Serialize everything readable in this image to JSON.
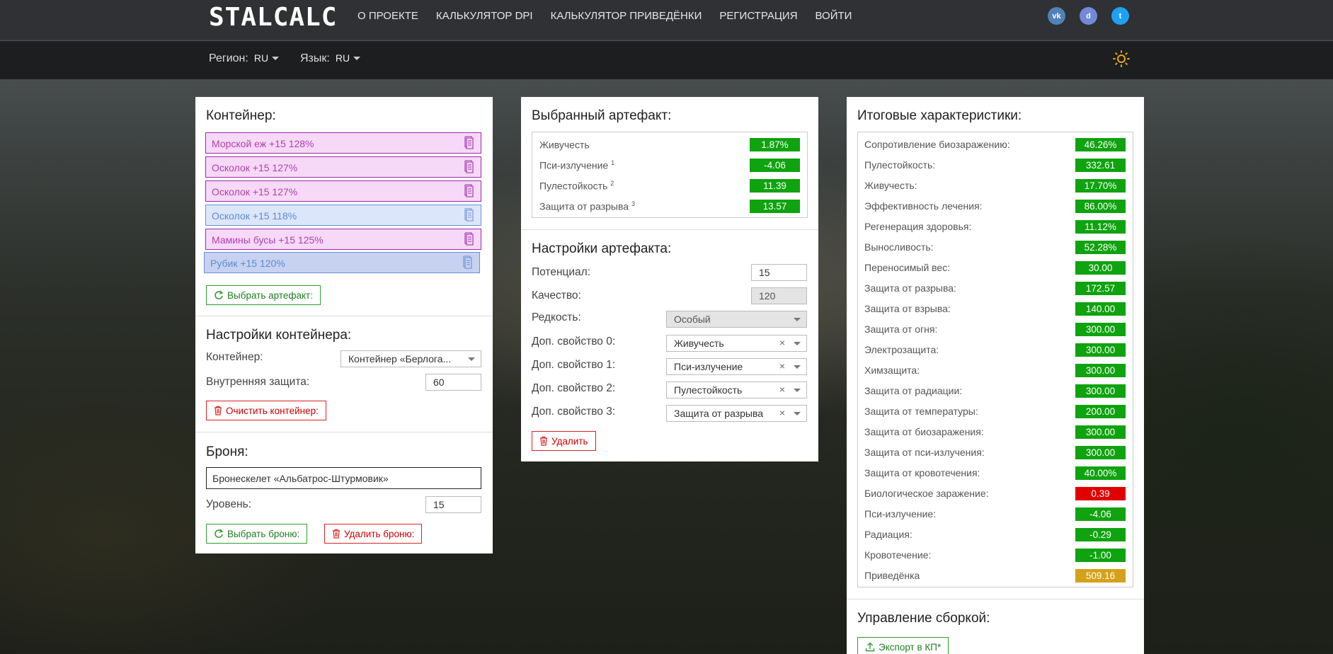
{
  "nav": {
    "logo": "STALCALC",
    "links": [
      "О ПРОЕКТЕ",
      "КАЛЬКУЛЯТОР DPI",
      "КАЛЬКУЛЯТОР ПРИВЕДЁНКИ",
      "РЕГИСТРАЦИЯ",
      "ВОЙТИ"
    ],
    "social": [
      {
        "icon": "vk-icon",
        "text": "vk",
        "color": "#5181b8"
      },
      {
        "icon": "discord-icon",
        "text": "d",
        "color": "#7289da"
      },
      {
        "icon": "twitter-icon",
        "text": "t",
        "color": "#1da1f2"
      }
    ]
  },
  "subbar": {
    "region_label": "Регион:",
    "region_value": "RU",
    "lang_label": "Язык:",
    "lang_value": "RU"
  },
  "container": {
    "title": "Контейнер:",
    "artifacts": [
      {
        "text": "Морской еж +15 128%",
        "color": "#b03fb0",
        "bg": "#f6d9f6",
        "border": "#9c2aa8"
      },
      {
        "text": "Осколок +15 127%",
        "color": "#b03fb0",
        "bg": "#f6d9f6",
        "border": "#9c2aa8"
      },
      {
        "text": "Осколок +15 127%",
        "color": "#b03fb0",
        "bg": "#f6d9f6",
        "border": "#9c2aa8"
      },
      {
        "text": "Осколок +15 118%",
        "color": "#5c8ad6",
        "bg": "#dce6fa",
        "border": "#6b8fd6"
      },
      {
        "text": "Мамины бусы +15 125%",
        "color": "#b03fb0",
        "bg": "#f6d9f6",
        "border": "#9c2aa8"
      },
      {
        "text": "Рубик +15 120%",
        "color": "#5c8ad6",
        "bg": "#c7d2f0",
        "border": "#6b8fd6"
      }
    ],
    "select_btn": "Выбрать артефакт:",
    "settings_title": "Настройки контейнера:",
    "container_label": "Контейнер:",
    "container_value": "Контейнер «Берлога...",
    "inner_label": "Внутренняя защита:",
    "inner_value": "60",
    "clear_btn": "Очистить контейнер:",
    "armor_title": "Броня:",
    "armor_value": "Бронескелет «Альбатрос-Штурмовик»",
    "level_label": "Уровень:",
    "level_value": "15",
    "choose_armor_btn": "Выбрать броню:",
    "delete_armor_btn": "Удалить броню:"
  },
  "selected": {
    "title": "Выбранный артефакт:",
    "stats": [
      {
        "name": "Живучесть",
        "sup": "",
        "value": "1.87%"
      },
      {
        "name": "Пси-излучение",
        "sup": "1",
        "value": "-4.06"
      },
      {
        "name": "Пулестойкость",
        "sup": "2",
        "value": "11.39"
      },
      {
        "name": "Защита от разрыва",
        "sup": "3",
        "value": "13.57"
      }
    ],
    "settings_title": "Настройки артефакта:",
    "potential_label": "Потенциал:",
    "potential_value": "15",
    "quality_label": "Качество:",
    "quality_value": "120",
    "rarity_label": "Редкость:",
    "rarity_value": "Особый",
    "props": [
      {
        "label": "Доп. свойство 0:",
        "value": "Живучесть"
      },
      {
        "label": "Доп. свойство 1:",
        "value": "Пси-излучение"
      },
      {
        "label": "Доп. свойство 2:",
        "value": "Пулестойкость"
      },
      {
        "label": "Доп. свойство 3:",
        "value": "Защита от разрыва"
      }
    ],
    "delete_btn": "Удалить"
  },
  "totals": {
    "title": "Итоговые характеристики:",
    "stats": [
      {
        "name": "Сопротивление биозаражению:",
        "value": "46.26%",
        "type": "green"
      },
      {
        "name": "Пулестойкость:",
        "value": "332.61",
        "type": "green"
      },
      {
        "name": "Живучесть:",
        "value": "17.70%",
        "type": "green"
      },
      {
        "name": "Эффективность лечения:",
        "value": "86.00%",
        "type": "green"
      },
      {
        "name": "Регенерация здоровья:",
        "value": "11.12%",
        "type": "green"
      },
      {
        "name": "Выносливость:",
        "value": "52.28%",
        "type": "green"
      },
      {
        "name": "Переносимый вес:",
        "value": "30.00",
        "type": "green"
      },
      {
        "name": "Защита от разрыва:",
        "value": "172.57",
        "type": "green"
      },
      {
        "name": "Защита от взрыва:",
        "value": "140.00",
        "type": "green"
      },
      {
        "name": "Защита от огня:",
        "value": "300.00",
        "type": "green"
      },
      {
        "name": "Электрозащита:",
        "value": "300.00",
        "type": "green"
      },
      {
        "name": "Химзащита:",
        "value": "300.00",
        "type": "green"
      },
      {
        "name": "Защита от радиации:",
        "value": "300.00",
        "type": "green"
      },
      {
        "name": "Защита от температуры:",
        "value": "200.00",
        "type": "green"
      },
      {
        "name": "Защита от биозаражения:",
        "value": "300.00",
        "type": "green"
      },
      {
        "name": "Защита от пси-излучения:",
        "value": "300.00",
        "type": "green"
      },
      {
        "name": "Защита от кровотечения:",
        "value": "40.00%",
        "type": "green"
      },
      {
        "name": "Биологическое заражение:",
        "value": "0.39",
        "type": "red"
      },
      {
        "name": "Пси-излучение:",
        "value": "-4.06",
        "type": "green"
      },
      {
        "name": "Радиация:",
        "value": "-0.29",
        "type": "green"
      },
      {
        "name": "Кровотечение:",
        "value": "-1.00",
        "type": "green"
      },
      {
        "name": "Приведёнка",
        "value": "509.16",
        "type": "gold"
      }
    ],
    "manage_title": "Управление сборкой:",
    "export_btn": "Экспорт в КП*"
  }
}
